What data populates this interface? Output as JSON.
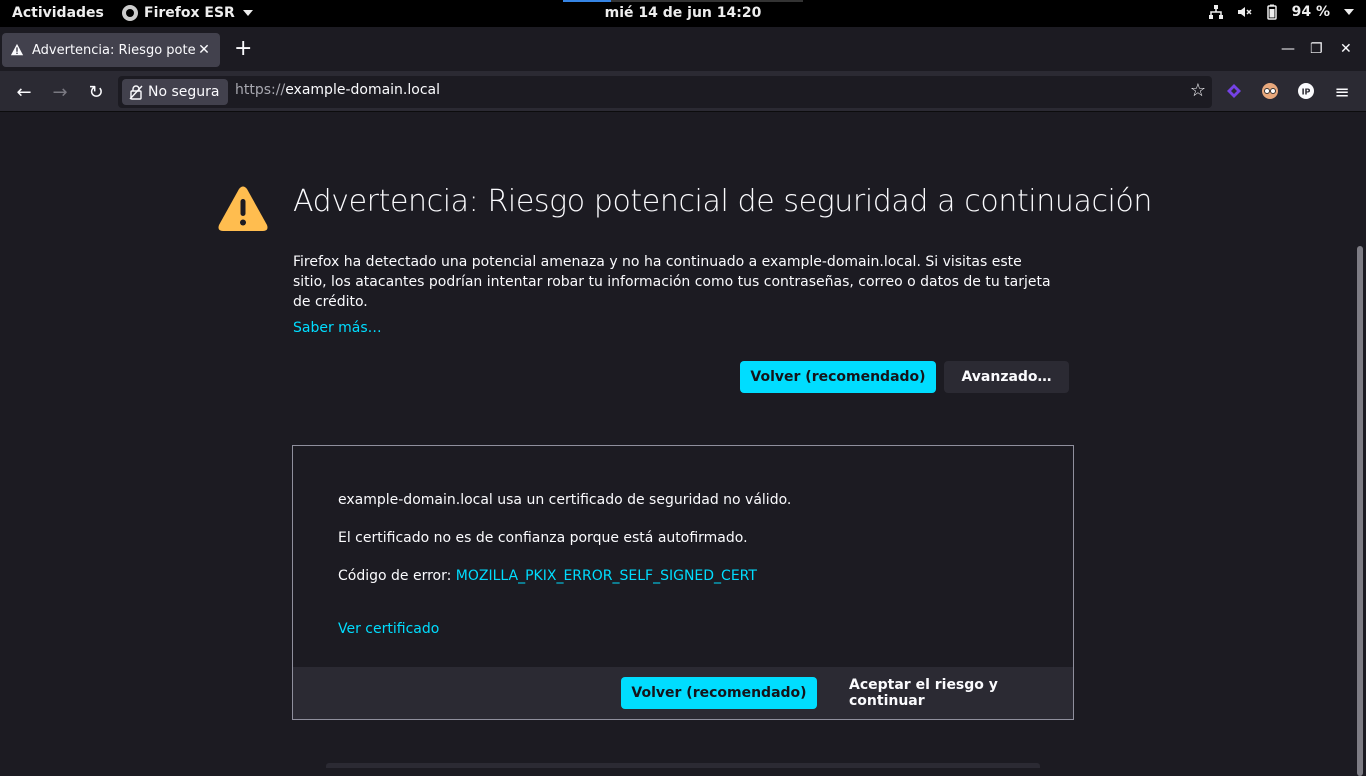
{
  "topbar": {
    "activities": "Actividades",
    "app_name": "Firefox ESR",
    "clock": "mié 14 de jun  14:20",
    "battery": "94 %"
  },
  "tab": {
    "title": "Advertencia: Riesgo potencial de seguridad a continuación",
    "close": "✕"
  },
  "newtab": "+",
  "window": {
    "minimize": "—",
    "maximize": "❐",
    "close": "✕"
  },
  "nav": {
    "back": "←",
    "forward": "→",
    "reload": "↻",
    "identity_label": "No segura",
    "url_scheme": "https://",
    "url_host": "example-domain.local",
    "bookmark": "☆",
    "menu": "≡"
  },
  "page": {
    "heading": "Advertencia: Riesgo potencial de seguridad a continuación",
    "description": "Firefox ha detectado una potencial amenaza y no ha continuado a example-domain.local. Si visitas este sitio, los atacantes podrían intentar robar tu información como tus contraseñas, correo o datos de tu tarjeta de crédito.",
    "learn_more": "Saber más…",
    "back_button": "Volver (recomendado)",
    "advanced_button": "Avanzado…"
  },
  "advanced": {
    "line1": "example-domain.local usa un certificado de seguridad no válido.",
    "line2": "El certificado no es de confianza porque está autofirmado.",
    "error_label": "Código de error: ",
    "error_code": "MOZILLA_PKIX_ERROR_SELF_SIGNED_CERT",
    "view_cert": "Ver certificado",
    "back_button": "Volver (recomendado)",
    "accept_button": "Aceptar el riesgo y continuar"
  },
  "colors": {
    "accent": "#00ddff",
    "warning": "#ffbd4f",
    "background": "#1c1b22",
    "toolbar": "#2b2a33"
  }
}
